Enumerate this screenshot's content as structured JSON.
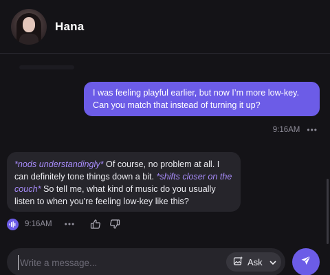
{
  "header": {
    "contact_name": "Hana",
    "avatar_icon": "user-avatar"
  },
  "messages": [
    {
      "role": "user",
      "text_line1": "I was feeling playful earlier, but now I’m more low-key.",
      "text_line2": "Can you match that instead of turning it up?",
      "time": "9:16AM",
      "more": "•••"
    },
    {
      "role": "assistant",
      "segments": [
        {
          "kind": "action",
          "text": "*nods understandingly*"
        },
        {
          "kind": "text",
          "text": " Of course, no problem at all. I can definitely tone things down a bit. "
        },
        {
          "kind": "action",
          "text": "*shifts closer on the couch*"
        },
        {
          "kind": "text",
          "text": " So tell me, what kind of music do you usually listen to when you're feeling low-key like this?"
        }
      ],
      "time": "9:16AM",
      "more": "•••",
      "icons": [
        "voice-play-icon",
        "thumbs-up-icon",
        "thumbs-down-icon"
      ]
    }
  ],
  "composer": {
    "placeholder": "Write a message...",
    "value": "",
    "ask_label": "Ask",
    "ask_icon": "image-sparkle-icon",
    "send_icon": "send-arrow-icon"
  },
  "colors": {
    "background": "#141317",
    "accent": "#6c5ce7",
    "bubble_ai": "#26252b",
    "action_text": "#a78bfa",
    "muted": "#8f8d99"
  }
}
